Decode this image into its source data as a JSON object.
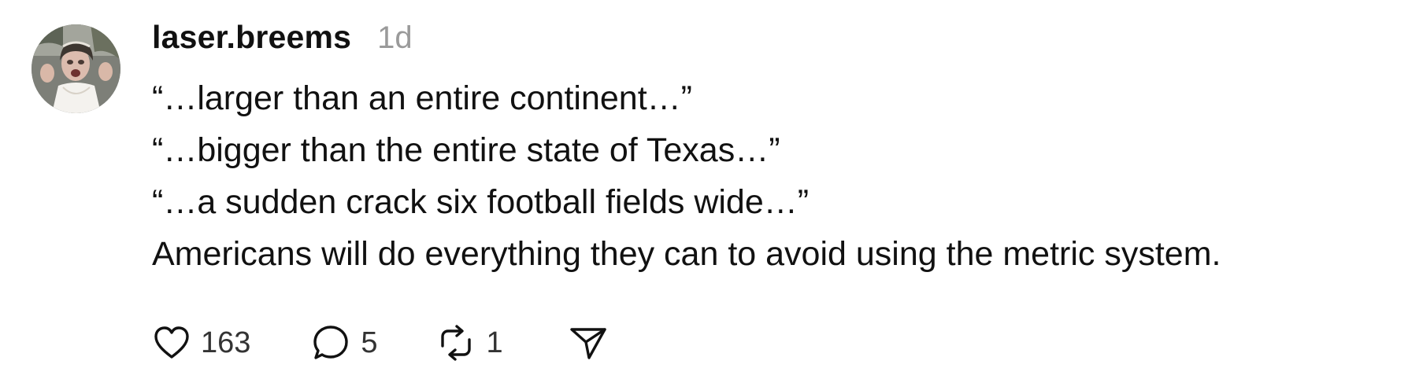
{
  "post": {
    "username": "laser.breems",
    "timestamp": "1d",
    "lines": [
      "“…larger than an entire continent…”",
      "“…bigger than the entire state of Texas…”",
      "“…a sudden crack six football fields wide…”",
      "Americans will do everything they can to avoid using the metric system."
    ],
    "actions": {
      "like": {
        "icon": "heart-icon",
        "count": "163"
      },
      "reply": {
        "icon": "speech-bubble-icon",
        "count": "5"
      },
      "repost": {
        "icon": "repost-icon",
        "count": "1"
      },
      "share": {
        "icon": "paper-plane-icon"
      }
    }
  }
}
